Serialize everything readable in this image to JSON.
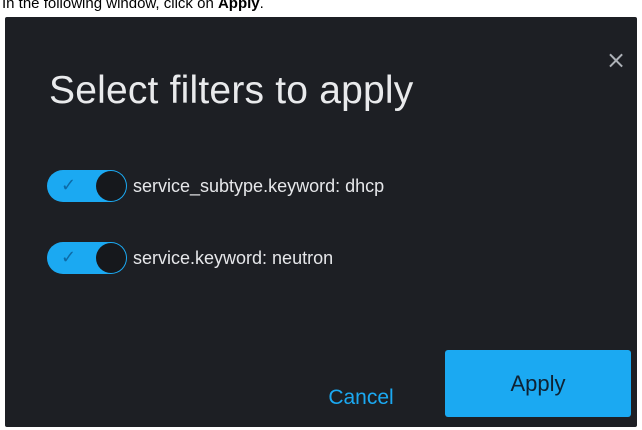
{
  "instruction": {
    "prefix": "In the following window, click on ",
    "target": "Apply",
    "suffix": "."
  },
  "dialog": {
    "title": "Select filters to apply",
    "close_icon": "close-icon",
    "close_glyph": "×",
    "filters": [
      {
        "label": "service_subtype.keyword: dhcp",
        "enabled": true,
        "check_glyph": "✓"
      },
      {
        "label": "service.keyword: neutron",
        "enabled": true,
        "check_glyph": "✓"
      }
    ],
    "cancel_label": "Cancel",
    "apply_label": "Apply"
  },
  "colors": {
    "dialog_bg": "#1d1f24",
    "accent": "#1ba9f2",
    "text": "#e6e7ea"
  }
}
